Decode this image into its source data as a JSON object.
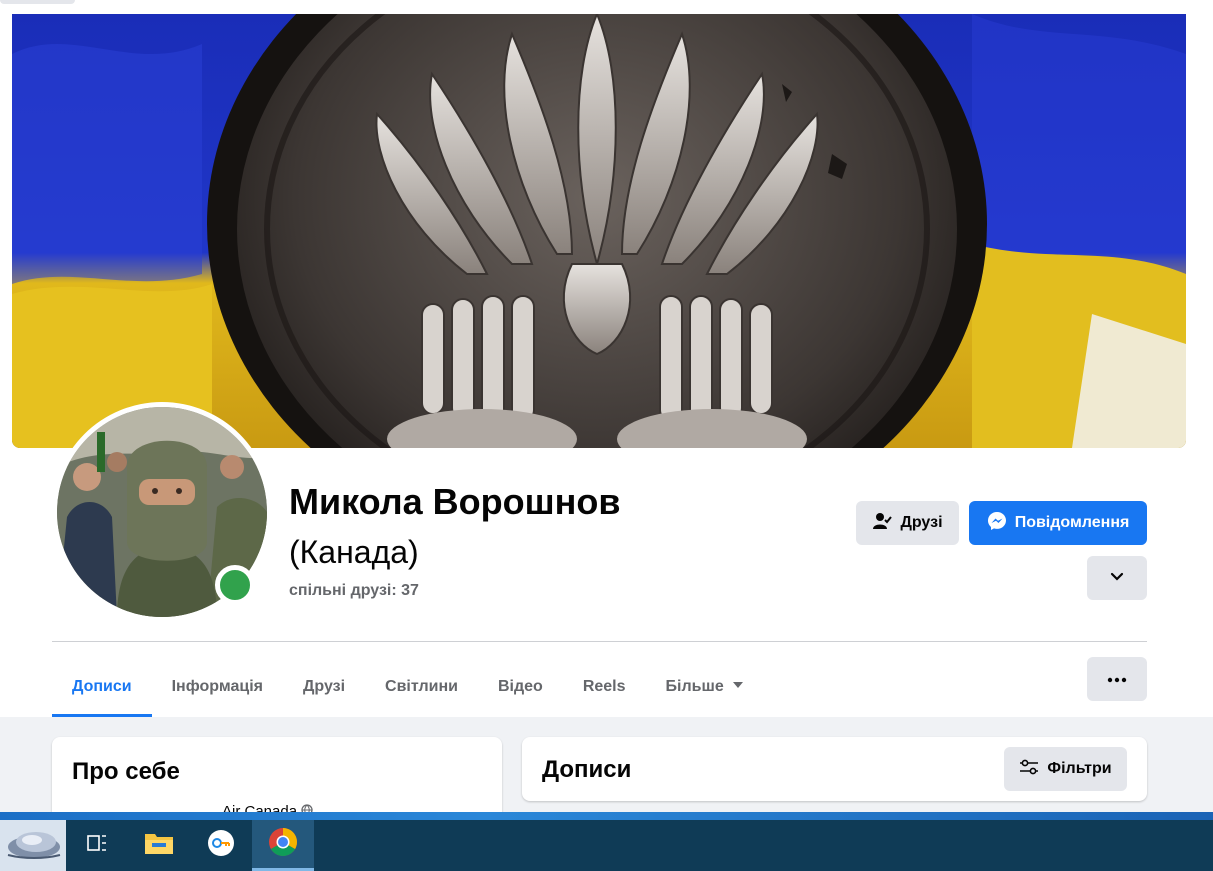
{
  "profile": {
    "name": "Микола Ворошнов",
    "alternate_name": "(Канада)",
    "mutual_friends": "спільні друзі: 37",
    "online": true
  },
  "actions": {
    "friends_label": "Друзі",
    "message_label": "Повідомлення"
  },
  "tabs": [
    {
      "label": "Дописи",
      "active": true
    },
    {
      "label": "Інформація"
    },
    {
      "label": "Друзі"
    },
    {
      "label": "Світлини"
    },
    {
      "label": "Відео"
    },
    {
      "label": "Reels"
    },
    {
      "label": "Більше"
    }
  ],
  "about": {
    "title": "Про себе",
    "partial_line": "Air Canada"
  },
  "posts": {
    "title": "Дописи",
    "filters_label": "Фільтри"
  },
  "icons": {
    "friends": "person-check-icon",
    "message": "messenger-icon",
    "more": "chevron-down-icon",
    "dots": "more-dots-icon",
    "filters": "sliders-icon"
  },
  "colors": {
    "accent": "#1877f2",
    "online": "#31a24c",
    "secondary_text": "#65676b"
  },
  "taskbar": [
    "start-icon",
    "task-view-icon",
    "file-explorer-icon",
    "keyring-app-icon",
    "chrome-icon"
  ]
}
